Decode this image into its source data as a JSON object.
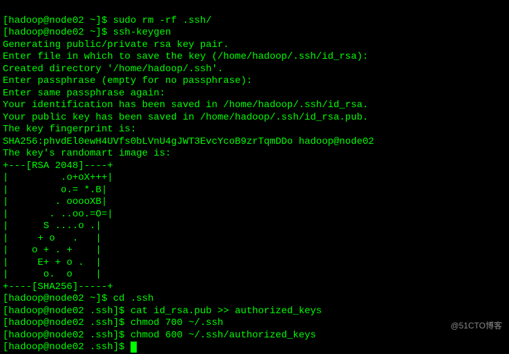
{
  "lines": {
    "l0": "[hadoop@node02 ~]$ sudo rm -rf .ssh/",
    "l1": "[hadoop@node02 ~]$ ssh-keygen",
    "l2": "Generating public/private rsa key pair.",
    "l3": "Enter file in which to save the key (/home/hadoop/.ssh/id_rsa):",
    "l4": "Created directory '/home/hadoop/.ssh'.",
    "l5": "Enter passphrase (empty for no passphrase):",
    "l6": "Enter same passphrase again:",
    "l7": "Your identification has been saved in /home/hadoop/.ssh/id_rsa.",
    "l8": "Your public key has been saved in /home/hadoop/.ssh/id_rsa.pub.",
    "l9": "The key fingerprint is:",
    "l10": "SHA256:phvdEl0ewH4UVfs0bLVnU4gJWT3EvcYcoB9zrTqmDDo hadoop@node02",
    "l11": "The key's randomart image is:",
    "l12": "+---[RSA 2048]----+",
    "l13": "|         .o+oX+++|",
    "l14": "|         o.= *.B|",
    "l15": "|        . ooooXB|",
    "l16": "|       . ..oo.=O=|",
    "l17": "|      S ....o .|",
    "l18": "|     + o   .   |",
    "l19": "|    o + . +    |",
    "l20": "|     E+ + o .  |",
    "l21": "|      o.  o    |",
    "l22": "+----[SHA256]-----+",
    "l23": "[hadoop@node02 ~]$ cd .ssh",
    "l24": "[hadoop@node02 .ssh]$ cat id_rsa.pub >> authorized_keys",
    "l25": "[hadoop@node02 .ssh]$ chmod 700 ~/.ssh",
    "l26": "[hadoop@node02 .ssh]$ chmod 600 ~/.ssh/authorized_keys",
    "l27": "[hadoop@node02 .ssh]$ "
  },
  "watermark": "@51CTO博客"
}
